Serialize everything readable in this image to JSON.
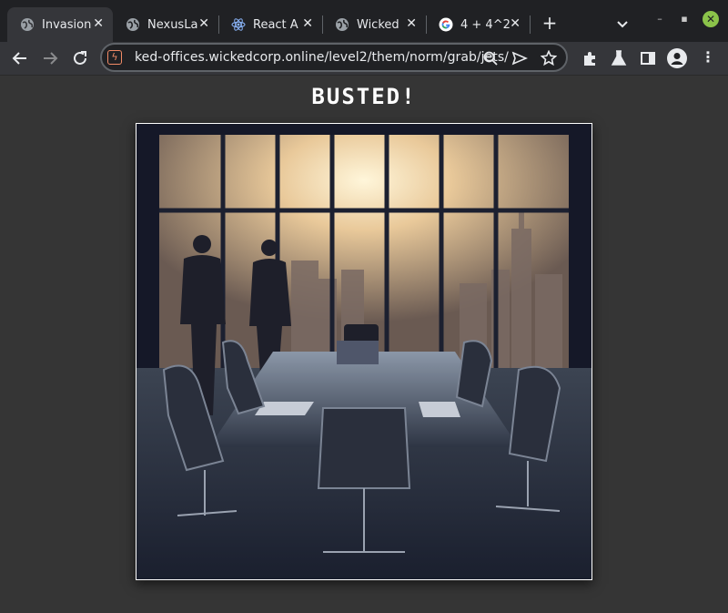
{
  "browser": {
    "tabs": [
      {
        "title": "Invasion",
        "icon": "globe-icon",
        "active": true
      },
      {
        "title": "NexusLa",
        "icon": "globe-icon",
        "active": false
      },
      {
        "title": "React A",
        "icon": "react-icon",
        "active": false
      },
      {
        "title": "Wicked",
        "icon": "globe-icon",
        "active": false
      },
      {
        "title": "4 + 4^2",
        "icon": "google-icon",
        "active": false
      }
    ],
    "new_tab_label": "+",
    "url": "ked-offices.wickedcorp.online/level2/them/norm/grab/jets/"
  },
  "page": {
    "heading": "BUSTED!",
    "image_alt": "Executives in a dark conference room overlooking a city skyline"
  },
  "colors": {
    "tab_bar": "#202124",
    "toolbar": "#35363a",
    "page_bg": "#353535",
    "close_button": "#8bc34a",
    "secure_icon": "#f28b66"
  }
}
